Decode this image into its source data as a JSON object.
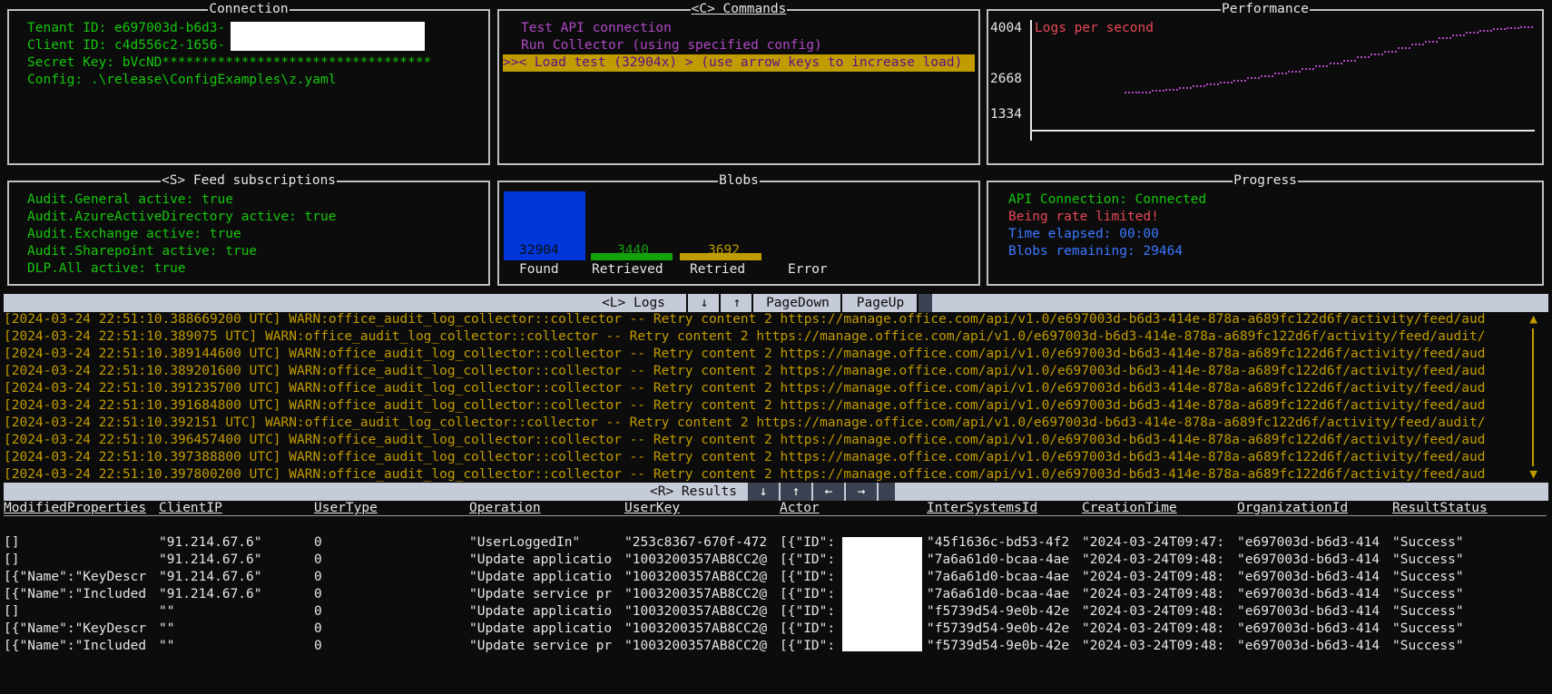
{
  "connection": {
    "title": "Connection",
    "lines": [
      "Tenant ID: e697003d-b6d3-",
      "Client ID: c4d556c2-1656-",
      "Secret Key: bVcND**********************************",
      "Config: .\\release\\ConfigExamples\\z.yaml"
    ]
  },
  "commands": {
    "title": "<C> Commands",
    "items": [
      "Test API connection",
      "Run Collector (using specified config)",
      ">>< Load test (32904x) > (use arrow keys to increase load)"
    ]
  },
  "performance": {
    "title": "Performance",
    "legend": "Logs per second",
    "y_ticks": [
      "4004",
      "2668",
      "1334"
    ]
  },
  "chart_data": {
    "type": "scatter",
    "title": "Logs per second",
    "ylim": [
      1334,
      4004
    ],
    "y_ticks": [
      4004,
      2668,
      1334
    ],
    "series": [
      {
        "name": "Logs per second",
        "values": [
          2280,
          2300,
          2330,
          2360,
          2400,
          2450,
          2490,
          2540,
          2580,
          2640,
          2700,
          2760,
          2810,
          2870,
          2940,
          3010,
          3080,
          3150,
          3220,
          3300,
          3380,
          3460,
          3540,
          3620,
          3700,
          3760,
          3810,
          3850,
          3880,
          3900
        ]
      }
    ]
  },
  "feeds": {
    "title": "<S> Feed subscriptions",
    "lines": [
      "Audit.General active: true",
      "Audit.AzureActiveDirectory active: true",
      "Audit.Exchange active: true",
      "Audit.Sharepoint active: true",
      "DLP.All active: true"
    ]
  },
  "blobs": {
    "title": "Blobs",
    "bars": [
      {
        "label": "Found",
        "value": "32904",
        "color": "#0037da"
      },
      {
        "label": "Retrieved",
        "value": "3440",
        "color": "#13a10e"
      },
      {
        "label": "Retried",
        "value": "3692",
        "color": "#c19c00"
      },
      {
        "label": "Error",
        "value": "",
        "color": "#c50f1f"
      }
    ]
  },
  "progress": {
    "title": "Progress",
    "api": "API Connection: Connected",
    "rate": "Being rate limited!",
    "elapsed": "Time elapsed: 00:00",
    "remaining": "Blobs remaining: 29464"
  },
  "logs_toolbar": {
    "title": "<L> Logs",
    "down": "↓",
    "up": "↑",
    "pagedown": "PageDown",
    "pageup": "PageUp"
  },
  "logs": [
    "[2024-03-24 22:51:10.388669200 UTC] WARN:office_audit_log_collector::collector -- Retry content 2 https://manage.office.com/api/v1.0/e697003d-b6d3-414e-878a-a689fc122d6f/activity/feed/aud",
    "[2024-03-24 22:51:10.389075 UTC] WARN:office_audit_log_collector::collector -- Retry content 2 https://manage.office.com/api/v1.0/e697003d-b6d3-414e-878a-a689fc122d6f/activity/feed/audit/",
    "[2024-03-24 22:51:10.389144600 UTC] WARN:office_audit_log_collector::collector -- Retry content 2 https://manage.office.com/api/v1.0/e697003d-b6d3-414e-878a-a689fc122d6f/activity/feed/aud",
    "[2024-03-24 22:51:10.389201600 UTC] WARN:office_audit_log_collector::collector -- Retry content 2 https://manage.office.com/api/v1.0/e697003d-b6d3-414e-878a-a689fc122d6f/activity/feed/aud",
    "[2024-03-24 22:51:10.391235700 UTC] WARN:office_audit_log_collector::collector -- Retry content 2 https://manage.office.com/api/v1.0/e697003d-b6d3-414e-878a-a689fc122d6f/activity/feed/aud",
    "[2024-03-24 22:51:10.391684800 UTC] WARN:office_audit_log_collector::collector -- Retry content 2 https://manage.office.com/api/v1.0/e697003d-b6d3-414e-878a-a689fc122d6f/activity/feed/aud",
    "[2024-03-24 22:51:10.392151 UTC] WARN:office_audit_log_collector::collector -- Retry content 2 https://manage.office.com/api/v1.0/e697003d-b6d3-414e-878a-a689fc122d6f/activity/feed/audit/",
    "[2024-03-24 22:51:10.396457400 UTC] WARN:office_audit_log_collector::collector -- Retry content 2 https://manage.office.com/api/v1.0/e697003d-b6d3-414e-878a-a689fc122d6f/activity/feed/aud",
    "[2024-03-24 22:51:10.397388800 UTC] WARN:office_audit_log_collector::collector -- Retry content 2 https://manage.office.com/api/v1.0/e697003d-b6d3-414e-878a-a689fc122d6f/activity/feed/aud",
    "[2024-03-24 22:51:10.397800200 UTC] WARN:office_audit_log_collector::collector -- Retry content 2 https://manage.office.com/api/v1.0/e697003d-b6d3-414e-878a-a689fc122d6f/activity/feed/aud"
  ],
  "results_toolbar": {
    "title": "<R> Results",
    "down": "↓",
    "up": "↑",
    "left": "←",
    "right": "→"
  },
  "results": {
    "columns": [
      "ModifiedProperties",
      "ClientIP",
      "UserType",
      "Operation",
      "UserKey",
      "Actor",
      "InterSystemsId",
      "CreationTime",
      "OrganizationId",
      "ResultStatus"
    ],
    "rows": [
      [
        "[]",
        "\"91.214.67.6\"",
        "0",
        "\"UserLoggedIn\"",
        "\"253c8367-670f-472",
        "[{\"ID\":",
        "\"45f1636c-bd53-4f2",
        "\"2024-03-24T09:47:",
        "\"e697003d-b6d3-414",
        "\"Success\""
      ],
      [
        "[]",
        "\"91.214.67.6\"",
        "0",
        "\"Update applicatio",
        "\"1003200357AB8CC2@",
        "[{\"ID\":",
        "\"7a6a61d0-bcaa-4ae",
        "\"2024-03-24T09:48:",
        "\"e697003d-b6d3-414",
        "\"Success\""
      ],
      [
        "[{\"Name\":\"KeyDescr",
        "\"91.214.67.6\"",
        "0",
        "\"Update applicatio",
        "\"1003200357AB8CC2@",
        "[{\"ID\":",
        "\"7a6a61d0-bcaa-4ae",
        "\"2024-03-24T09:48:",
        "\"e697003d-b6d3-414",
        "\"Success\""
      ],
      [
        "[{\"Name\":\"Included",
        "\"91.214.67.6\"",
        "0",
        "\"Update service pr",
        "\"1003200357AB8CC2@",
        "[{\"ID\":",
        "\"7a6a61d0-bcaa-4ae",
        "\"2024-03-24T09:48:",
        "\"e697003d-b6d3-414",
        "\"Success\""
      ],
      [
        "[]",
        "\"\"",
        "0",
        "\"Update applicatio",
        "\"1003200357AB8CC2@",
        "[{\"ID\":",
        "\"f5739d54-9e0b-42e",
        "\"2024-03-24T09:48:",
        "\"e697003d-b6d3-414",
        "\"Success\""
      ],
      [
        "[{\"Name\":\"KeyDescr",
        "\"\"",
        "0",
        "\"Update applicatio",
        "\"1003200357AB8CC2@",
        "[{\"ID\":",
        "\"f5739d54-9e0b-42e",
        "\"2024-03-24T09:48:",
        "\"e697003d-b6d3-414",
        "\"Success\""
      ],
      [
        "[{\"Name\":\"Included",
        "\"\"",
        "0",
        "\"Update service pr",
        "\"1003200357AB8CC2@",
        "[{\"ID\":",
        "\"f5739d54-9e0b-42e",
        "\"2024-03-24T09:48:",
        "\"e697003d-b6d3-414",
        "\"Success\""
      ]
    ]
  }
}
